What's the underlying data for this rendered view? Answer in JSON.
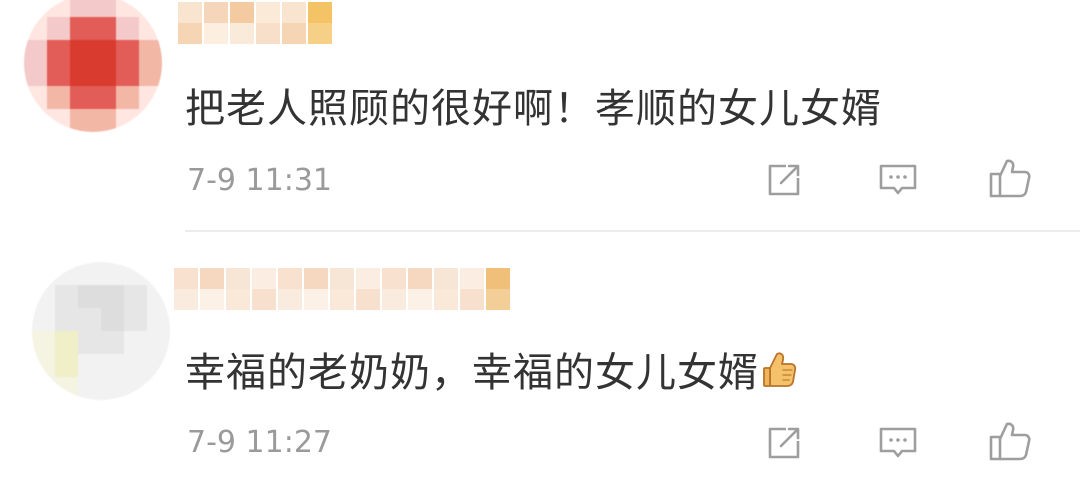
{
  "comments": [
    {
      "text": "把老人照顾的很好啊！孝顺的女儿女婿",
      "time": "7-9 11:31",
      "emoji": "",
      "avatar_colors": [
        "#f4c9c9",
        "#e25d57",
        "#d93c2f",
        "#f3b7a6",
        "#ffe6e0"
      ],
      "username_colors": [
        "#f8e3cc",
        "#f6d4b7",
        "#f3c79c",
        "#fbe9d6"
      ],
      "username_badge_color": "#f2c05d"
    },
    {
      "text": "幸福的老奶奶，幸福的女儿女婿",
      "time": "7-9 11:27",
      "emoji": "thumbs-up",
      "avatar_colors": [
        "#f2f2f2",
        "#e6e6e6",
        "#dddddd",
        "#f5f3e1",
        "#f0efc7"
      ],
      "username_colors": [
        "#f8e0cc",
        "#f6d5bd",
        "#f7e5d4",
        "#fbecdf"
      ],
      "username_badge_color": "#efbd74"
    }
  ],
  "actions": {
    "share_icon": "share-icon",
    "comment_icon": "comment-icon",
    "like_icon": "thumbs-up-icon"
  },
  "colors": {
    "text": "#333333",
    "time": "#9a9a9a",
    "icon": "#9e9e9e",
    "divider": "#ececec"
  }
}
